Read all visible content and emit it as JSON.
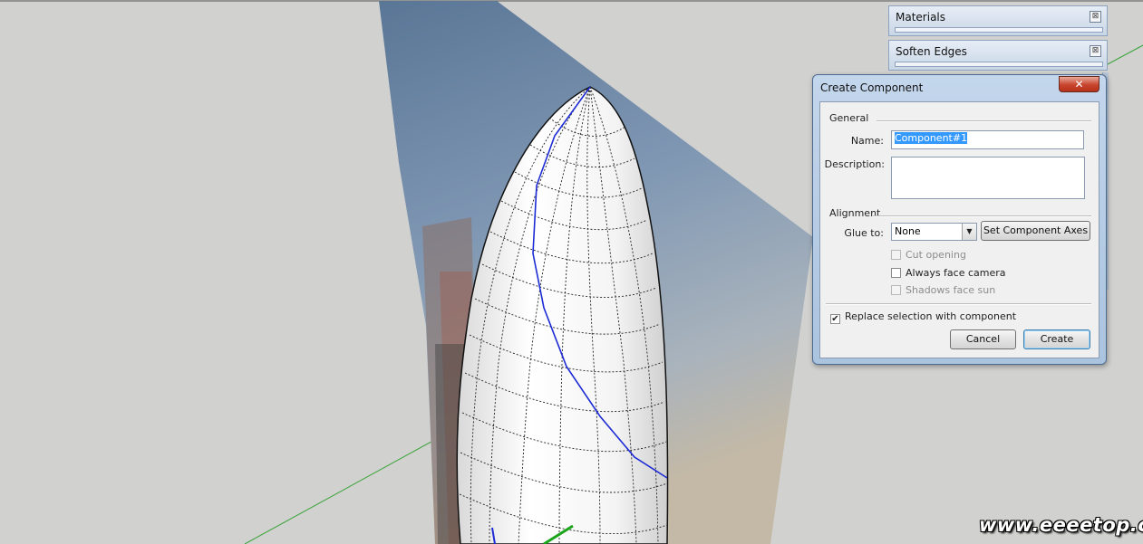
{
  "tray": {
    "panels": [
      {
        "title": "Materials"
      },
      {
        "title": "Soften Edges"
      }
    ],
    "close_glyph": "⊠"
  },
  "dialog": {
    "title": "Create Component",
    "close_glyph": "✕",
    "general_label": "General",
    "name_label": "Name:",
    "name_value": "Component#1",
    "description_label": "Description:",
    "description_value": "",
    "alignment_label": "Alignment",
    "glue_label": "Glue to:",
    "glue_value": "None",
    "set_axes_label": "Set Component Axes",
    "cut_opening_label": "Cut opening",
    "always_face_camera_label": "Always face camera",
    "shadows_face_sun_label": "Shadows face sun",
    "replace_selection_label": "Replace selection with component",
    "replace_selection_checked": true,
    "cancel_label": "Cancel",
    "create_label": "Create"
  },
  "watermark": "www.eeeetop.com"
}
